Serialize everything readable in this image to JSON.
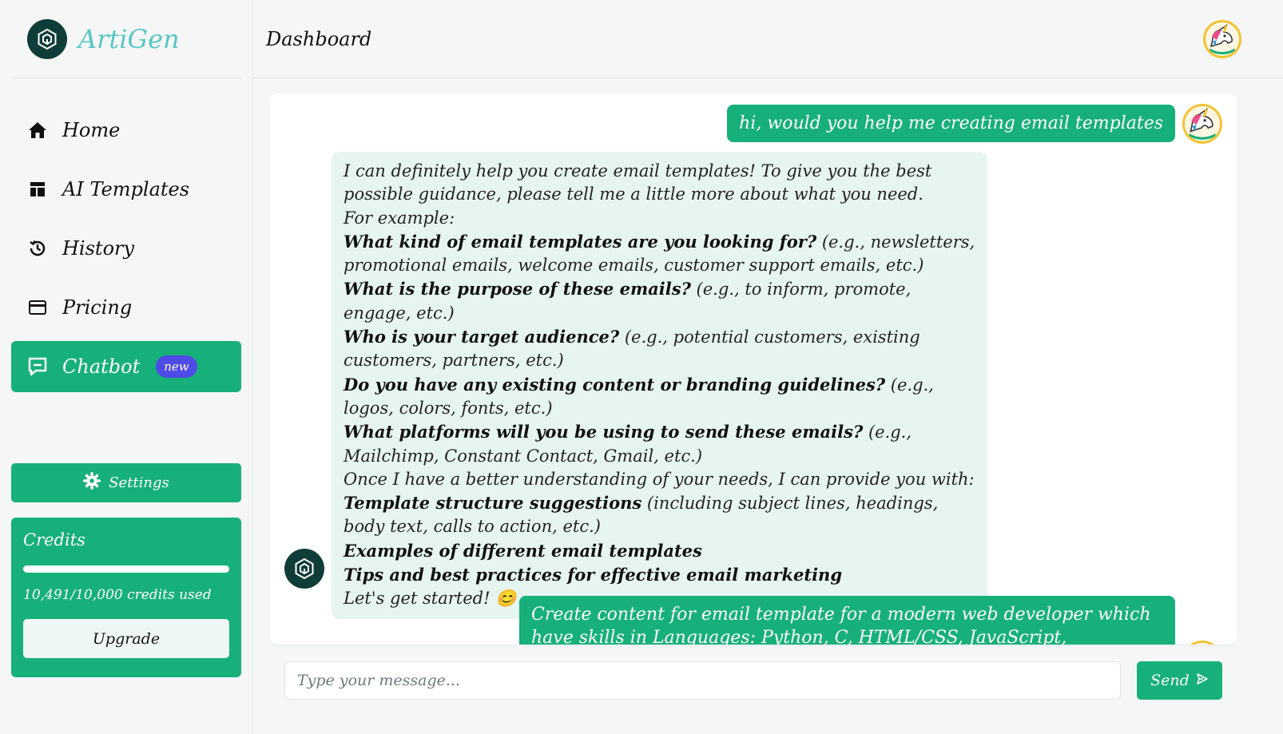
{
  "brand": {
    "name": "ArtiGen"
  },
  "nav": {
    "items": [
      {
        "label": "Home",
        "icon": "home-icon"
      },
      {
        "label": "AI Templates",
        "icon": "templates-icon"
      },
      {
        "label": "History",
        "icon": "history-icon"
      },
      {
        "label": "Pricing",
        "icon": "credit-card-icon"
      },
      {
        "label": "Chatbot",
        "icon": "chat-icon",
        "badge": "new",
        "active": true
      }
    ]
  },
  "settings": {
    "label": "Settings"
  },
  "credits": {
    "title": "Credits",
    "used_text": "10,491/10,000 credits used",
    "progress_fraction": 1.0,
    "upgrade_label": "Upgrade"
  },
  "header": {
    "title": "Dashboard"
  },
  "chat": {
    "user_message_1": "hi, would you help me creating email templates",
    "bot_message": {
      "intro": "I can definitely help you create email templates! To give you the best possible guidance, please tell me a little more about what you need.",
      "for_example": "For example:",
      "questions": [
        {
          "bold": "What kind of email templates are you looking for?",
          "rest": " (e.g., newsletters, promotional emails, welcome emails, customer support emails, etc.)"
        },
        {
          "bold": "What is the purpose of these emails?",
          "rest": " (e.g., to inform, promote, engage, etc.)"
        },
        {
          "bold": "Who is your target audience?",
          "rest": " (e.g., potential customers, existing customers, partners, etc.)"
        },
        {
          "bold": "Do you have any existing content or branding guidelines?",
          "rest": " (e.g., logos, colors, fonts, etc.)"
        },
        {
          "bold": "What platforms will you be using to send these emails?",
          "rest": " (e.g., Mailchimp, Constant Contact, Gmail, etc.)"
        }
      ],
      "once": "Once I have a better understanding of your needs, I can provide you with:",
      "offers": [
        {
          "bold": "Template structure suggestions",
          "rest": " (including subject lines, headings, body text, calls to action, etc.)"
        },
        {
          "bold": "Examples of different email templates",
          "rest": ""
        },
        {
          "bold": "Tips and best practices for effective email marketing",
          "rest": ""
        }
      ],
      "closing": "Let's get started! 😊"
    },
    "user_message_2": "Create content for email template for a modern web developer which have skills in Languages: Python, C, HTML/CSS, JavaScript, TypeScript, Tailwind CSS, React,"
  },
  "input": {
    "placeholder": "Type your message...",
    "send_label": "Send"
  },
  "colors": {
    "accent": "#17b07a",
    "brand_text": "#56c7c3",
    "logo_bg": "#0f3d3a",
    "badge": "#4f4be6",
    "bot_bubble": "#e6f5ef"
  }
}
